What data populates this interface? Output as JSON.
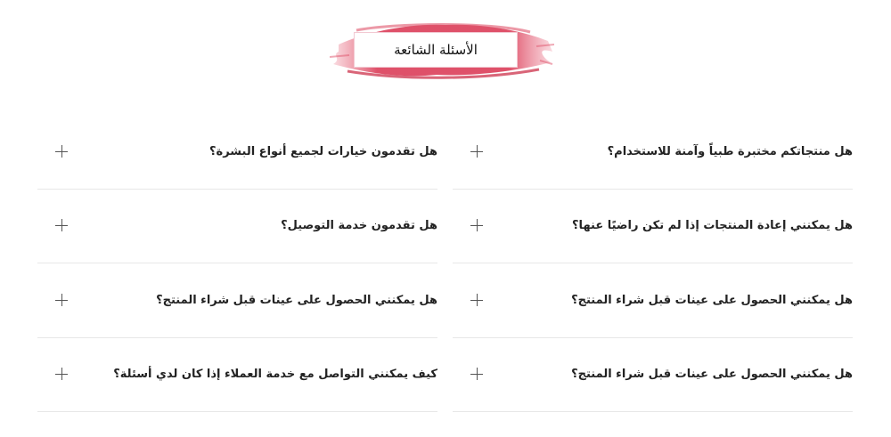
{
  "section_title": "الأسئلة الشائعة",
  "accent_color": "#d9324f",
  "faq": {
    "right_column": [
      {
        "question": "هل منتجاتكم مختبرة طبياً وآمنة للاستخدام؟",
        "icon": "plus-icon"
      },
      {
        "question": "هل يمكنني إعادة المنتجات إذا لم تكن راضيًا عنها؟",
        "icon": "plus-icon"
      },
      {
        "question": "هل يمكنني الحصول على عينات قبل شراء المنتج؟",
        "icon": "plus-icon"
      },
      {
        "question": "هل يمكنني الحصول على عينات قبل شراء المنتج؟",
        "icon": "plus-icon"
      }
    ],
    "left_column": [
      {
        "question": "هل تقدمون خيارات لجميع أنواع البشرة؟",
        "icon": "plus-icon"
      },
      {
        "question": "هل تقدمون خدمة التوصيل؟",
        "icon": "plus-icon"
      },
      {
        "question": "هل يمكنني الحصول على عينات قبل شراء المنتج؟",
        "icon": "plus-icon"
      },
      {
        "question": "كيف يمكنني التواصل مع خدمة العملاء إذا كان لدي أسئلة؟",
        "icon": "plus-icon"
      }
    ]
  }
}
